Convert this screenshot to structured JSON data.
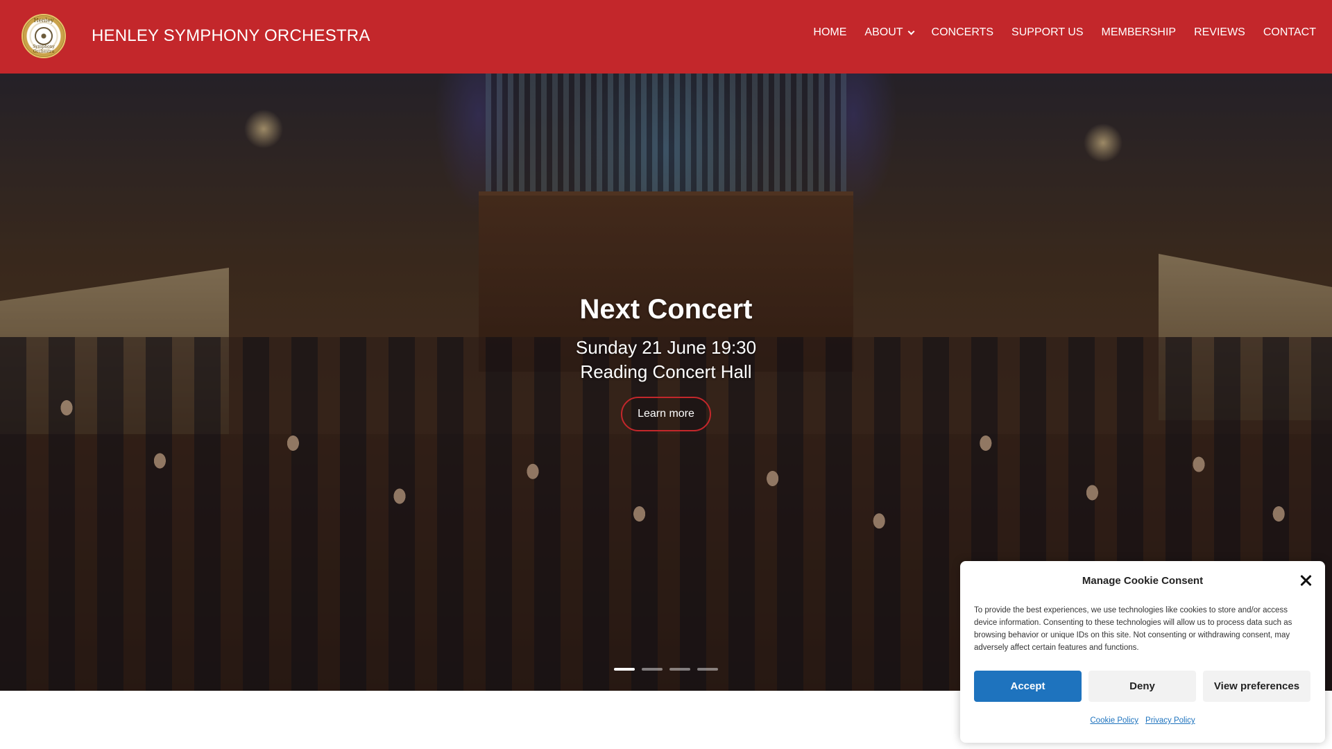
{
  "header": {
    "logo_text_top": "Henley",
    "logo_text_bottom": "Symphony Orchestra",
    "site_title": "HENLEY SYMPHONY ORCHESTRA",
    "nav": [
      {
        "label": "HOME"
      },
      {
        "label": "ABOUT",
        "has_dropdown": true
      },
      {
        "label": "CONCERTS"
      },
      {
        "label": "SUPPORT US"
      },
      {
        "label": "MEMBERSHIP"
      },
      {
        "label": "REVIEWS"
      },
      {
        "label": "CONTACT"
      }
    ],
    "brand_color": "#c3272b"
  },
  "hero": {
    "heading": "Next Concert",
    "date_line": "Sunday 21 June 19:30",
    "venue_line": "Reading Concert Hall",
    "button_label": "Learn more",
    "slides_count": 4,
    "active_slide": 1
  },
  "cookie": {
    "title": "Manage Cookie Consent",
    "text": "To provide the best experiences, we use technologies like cookies to store and/or access device information. Consenting to these technologies will allow us to process data such as browsing behavior or unique IDs on this site. Not consenting or withdrawing consent, may adversely affect certain features and functions.",
    "accept_label": "Accept",
    "deny_label": "Deny",
    "preferences_label": "View preferences",
    "cookie_policy_label": "Cookie Policy",
    "privacy_policy_label": "Privacy Policy",
    "accent_color": "#1e73be"
  }
}
